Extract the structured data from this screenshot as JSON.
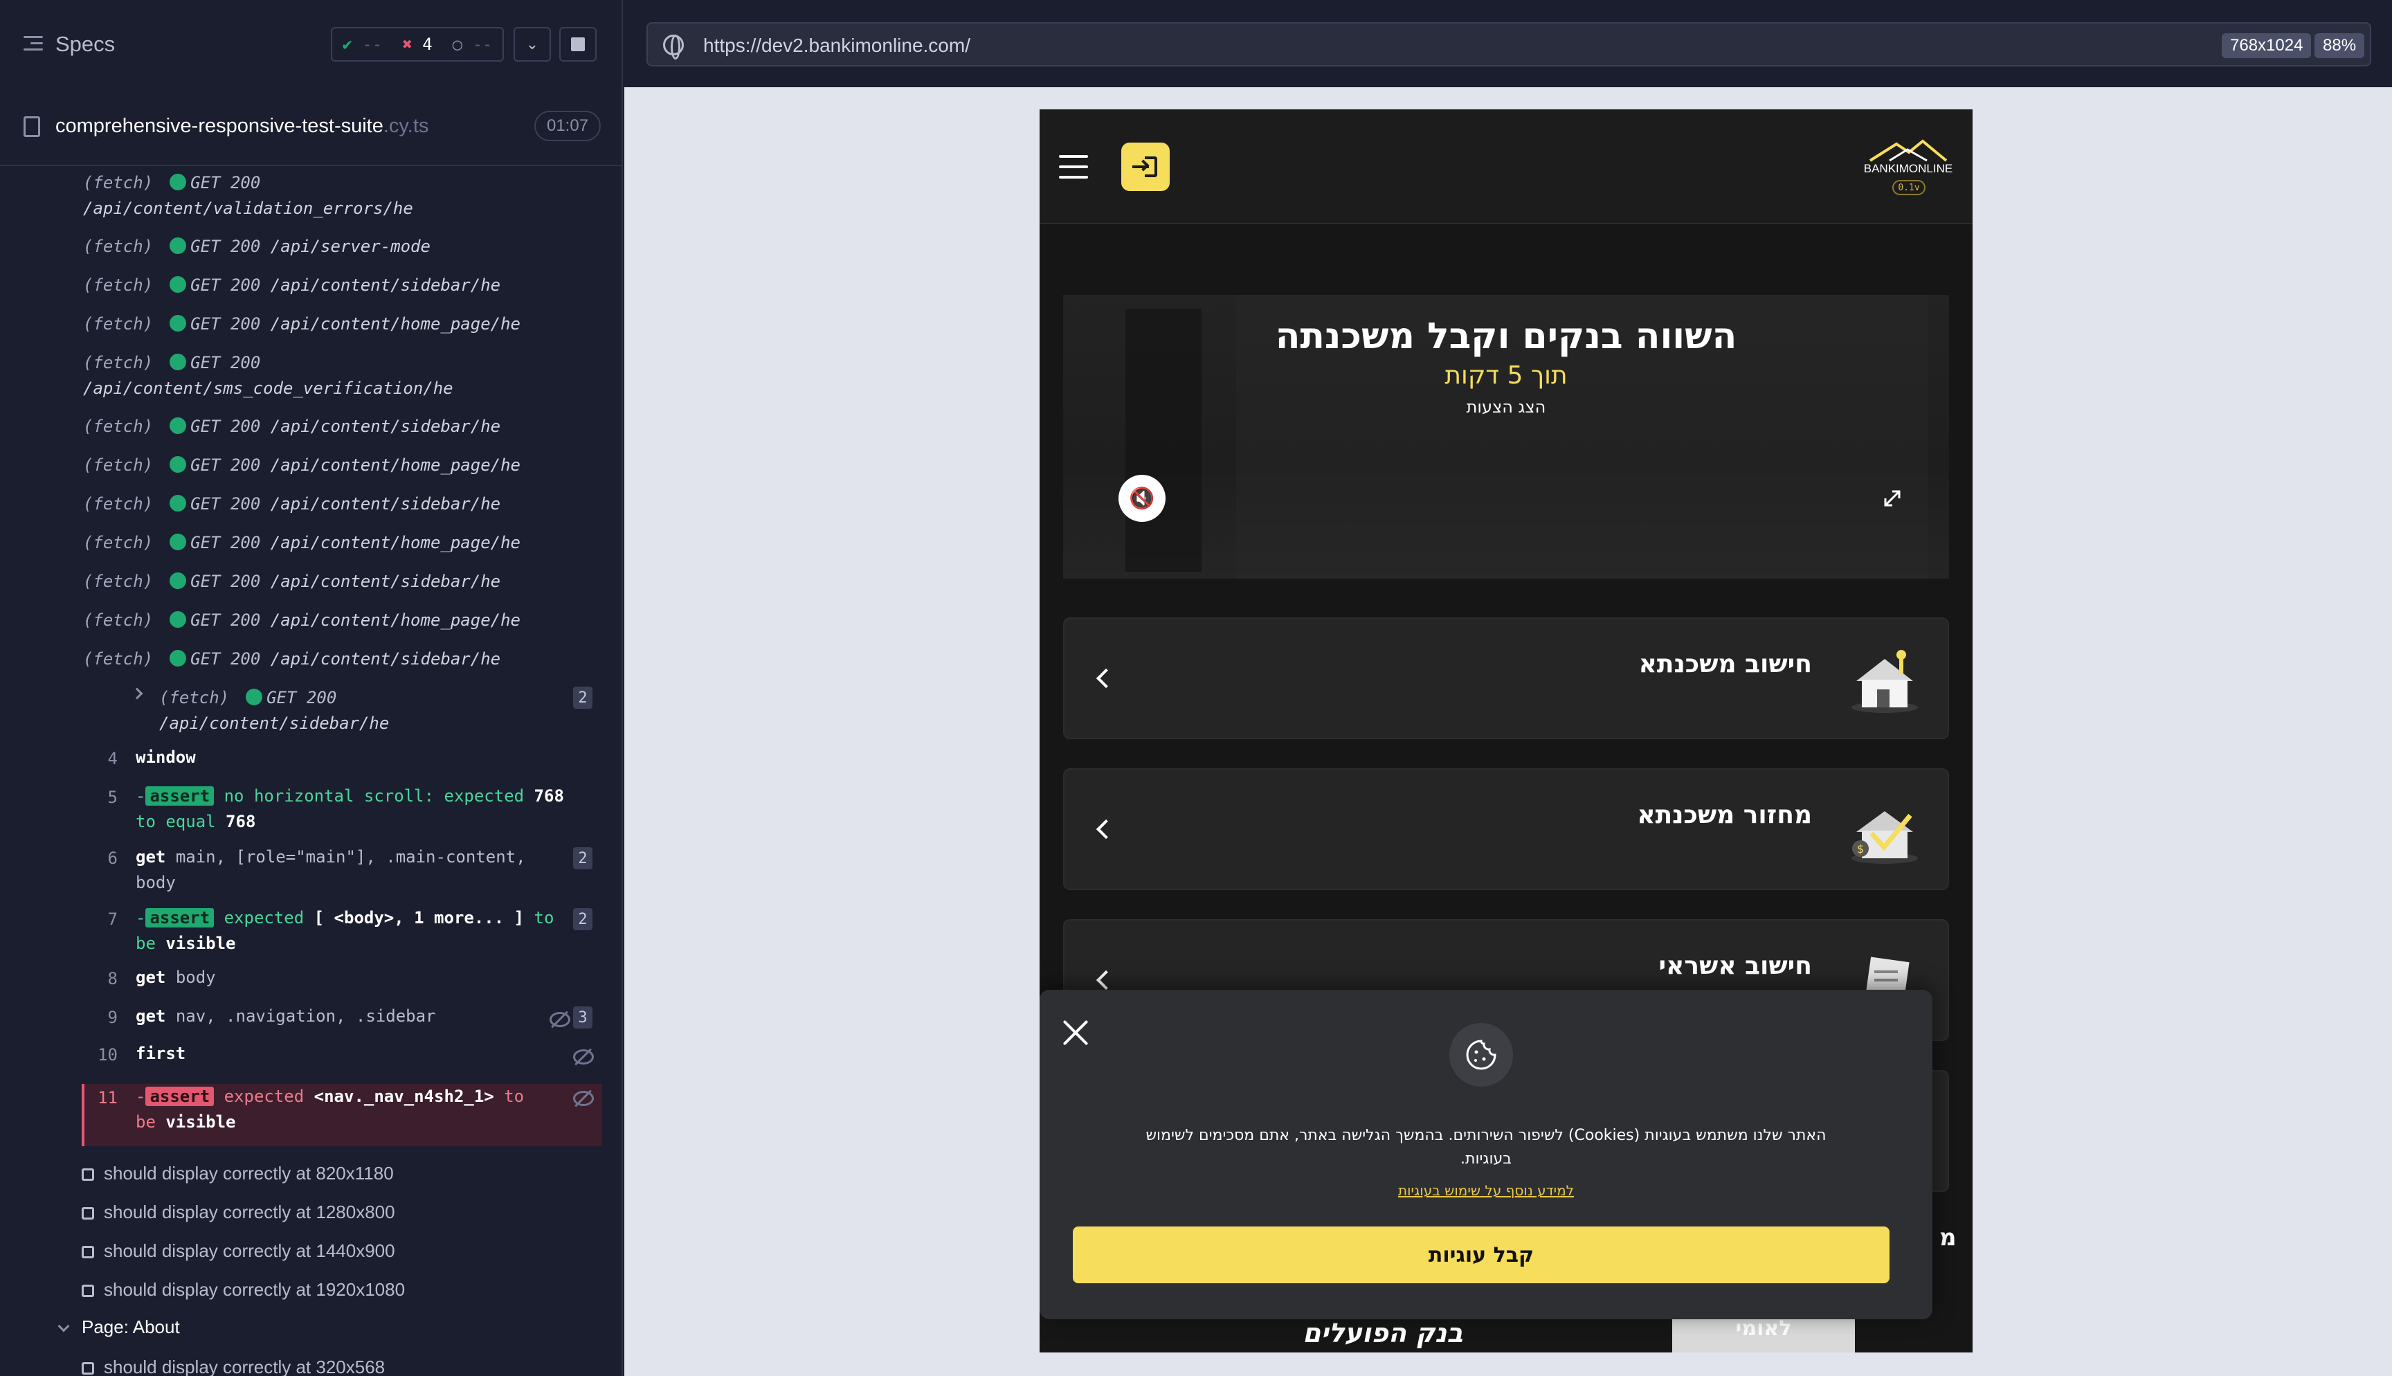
{
  "reporter": {
    "header": {
      "title": "Specs",
      "passed": "--",
      "failed": "4",
      "pending": "--"
    },
    "spec": {
      "name": "comprehensive-responsive-test-suite",
      "ext": ".cy.ts",
      "duration": "01:07"
    },
    "fetches": [
      {
        "type": "(fetch)",
        "status": "GET 200",
        "path": "/api/content/validation_errors/he"
      },
      {
        "type": "(fetch)",
        "status": "GET 200",
        "path": "/api/server-mode"
      },
      {
        "type": "(fetch)",
        "status": "GET 200",
        "path": "/api/content/sidebar/he"
      },
      {
        "type": "(fetch)",
        "status": "GET 200",
        "path": "/api/content/home_page/he"
      },
      {
        "type": "(fetch)",
        "status": "GET 200",
        "path": "/api/content/sms_code_verification/he"
      },
      {
        "type": "(fetch)",
        "status": "GET 200",
        "path": "/api/content/sidebar/he"
      },
      {
        "type": "(fetch)",
        "status": "GET 200",
        "path": "/api/content/home_page/he"
      },
      {
        "type": "(fetch)",
        "status": "GET 200",
        "path": "/api/content/sidebar/he"
      },
      {
        "type": "(fetch)",
        "status": "GET 200",
        "path": "/api/content/home_page/he"
      },
      {
        "type": "(fetch)",
        "status": "GET 200",
        "path": "/api/content/sidebar/he"
      },
      {
        "type": "(fetch)",
        "status": "GET 200",
        "path": "/api/content/home_page/he"
      },
      {
        "type": "(fetch)",
        "status": "GET 200",
        "path": "/api/content/sidebar/he"
      }
    ],
    "fetch_group": {
      "type": "(fetch)",
      "status": "GET 200",
      "path": "/api/content/sidebar/he",
      "count": "2"
    },
    "commands": {
      "c4": {
        "num": "4",
        "name": "window"
      },
      "c5": {
        "num": "5",
        "badge": "assert",
        "text": "no horizontal scroll: expected",
        "v1": "768",
        "mid": "to equal",
        "v2": "768"
      },
      "c6": {
        "num": "6",
        "name": "get",
        "arg": "main, [role=\"main\"], .main-content, body",
        "count": "2"
      },
      "c7": {
        "num": "7",
        "badge": "assert",
        "text": "expected",
        "v1": "[ <body>, 1 more... ]",
        "mid": "to",
        "tail": "be",
        "v2": "visible",
        "count": "2"
      },
      "c8": {
        "num": "8",
        "name": "get",
        "arg": "body"
      },
      "c9": {
        "num": "9",
        "name": "get",
        "arg": "nav, .navigation, .sidebar",
        "count": "3"
      },
      "c10": {
        "num": "10",
        "name": "first"
      },
      "c11": {
        "num": "11",
        "badge": "assert",
        "text": "expected",
        "v1": "<nav._nav_n4sh2_1>",
        "mid": "to",
        "tail": "be",
        "v2": "visible"
      }
    },
    "tests": [
      "should display correctly at 820x1180",
      "should display correctly at 1280x800",
      "should display correctly at 1440x900",
      "should display correctly at 1920x1080"
    ],
    "suite": "Page: About",
    "next_test": "should display correctly at 320x568"
  },
  "browser": {
    "url": "https://dev2.bankimonline.com/",
    "viewport": "768x1024",
    "zoom": "88%"
  },
  "app": {
    "logo_text": "BANKIMONLINE",
    "logo_version": "0.1v",
    "hero": {
      "title": "השווה בנקים וקבל משכנתה",
      "subtitle": "תוך 5 דקות",
      "small": "הצג הצעות"
    },
    "cards": [
      {
        "title": "חישוב משכנתא",
        "icon": "house-icon"
      },
      {
        "title": "מחזור משכנתא",
        "icon": "refinance-house-icon"
      },
      {
        "title": "חישוב אשראי",
        "icon": "document-icon"
      }
    ],
    "cookie": {
      "text": "האתר שלנו משתמש בעוגיות (Cookies) לשיפור השירותים. בהמשך הגלישה באתר, אתם מסכימים לשימוש בעוגיות.",
      "link": "למידע נוסף על שימוש בעוגיות",
      "accept": "קבל עוגיות"
    },
    "banks": {
      "hapoalim": "בנק הפועלים",
      "leumi": "לאומי"
    },
    "side_letter": "מ"
  },
  "colors": {
    "accent": "#f6dd5b",
    "pass": "#1fa971",
    "fail": "#e45770",
    "reporter_bg": "#1b1e2e"
  }
}
